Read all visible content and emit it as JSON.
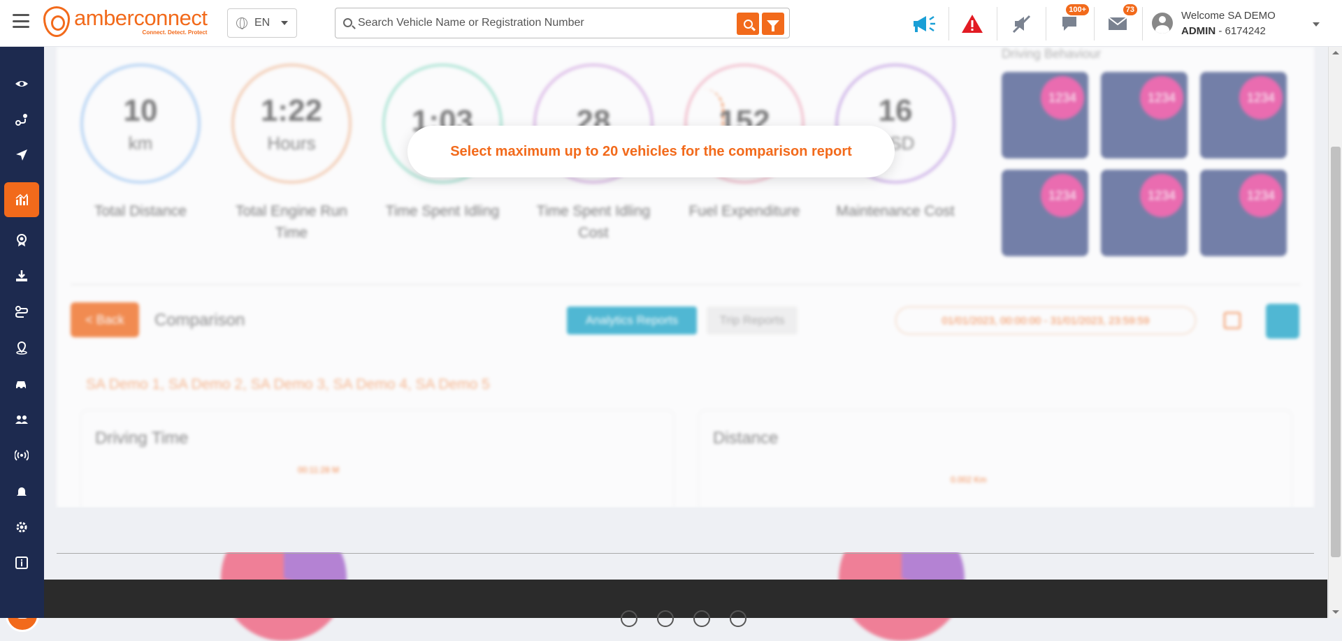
{
  "header": {
    "logo_name": "amberconnect",
    "logo_tagline": "Connect. Detect. Protect",
    "language": "EN",
    "search_placeholder": "Search Vehicle Name or Registration Number",
    "notifications_badge": "100+",
    "messages_badge": "73",
    "welcome_text": "Welcome SA DEMO",
    "user_role": "ADMIN",
    "user_id": " - 6174242"
  },
  "toast": {
    "message": "Select maximum up to 20 vehicles for the comparison report"
  },
  "stats": [
    {
      "value": "10",
      "unit": "km",
      "label": "Total Distance",
      "color": "#a7ccf5"
    },
    {
      "value": "1:22",
      "unit": "Hours",
      "label": "Total Engine Run Time",
      "color": "#f5c4a4"
    },
    {
      "value": "1:03",
      "unit": "",
      "label": "Time Spent Idling",
      "color": "#9ee3cf"
    },
    {
      "value": "28",
      "unit": "",
      "label": "Time Spent Idling Cost",
      "color": "#d9b1e6"
    },
    {
      "value": "152",
      "unit": "",
      "label": "Fuel Expenditure",
      "color": "#f5b8c8"
    },
    {
      "value": "16",
      "unit": "USD",
      "label": "Maintenance Cost",
      "color": "#c8a7e6"
    }
  ],
  "driving_behaviour": {
    "title": "Driving Behaviour",
    "badges": [
      "1234",
      "1234",
      "1234",
      "1234",
      "1234",
      "1234"
    ]
  },
  "comparison": {
    "back_label": "< Back",
    "title": "Comparison",
    "tab_analytics": "Analytics Reports",
    "tab_trip": "Trip Reports",
    "date_range": "01/01/2023, 00:00:00 - 31/01/2023, 23:59:59",
    "vehicles": "SA Demo 1, SA Demo 2, SA Demo 3, SA Demo 4, SA Demo 5",
    "chart1_title": "Driving Time",
    "chart1_annotation": "00:11:28 M",
    "chart2_title": "Distance",
    "chart2_annotation": "0.002 Km"
  },
  "colors": {
    "brand": "#f26a1b",
    "sidebar": "#1d2a4f",
    "accent_blue": "#1ba5c8",
    "alert_red": "#e21b23"
  },
  "sidebar_icons": [
    "eye-icon",
    "route-icon",
    "navigate-icon",
    "analytics-icon",
    "award-icon",
    "download-icon",
    "trip-icon",
    "location-icon",
    "vehicle-icon",
    "users-icon",
    "signal-icon",
    "bell-icon",
    "settings-icon",
    "info-icon"
  ]
}
